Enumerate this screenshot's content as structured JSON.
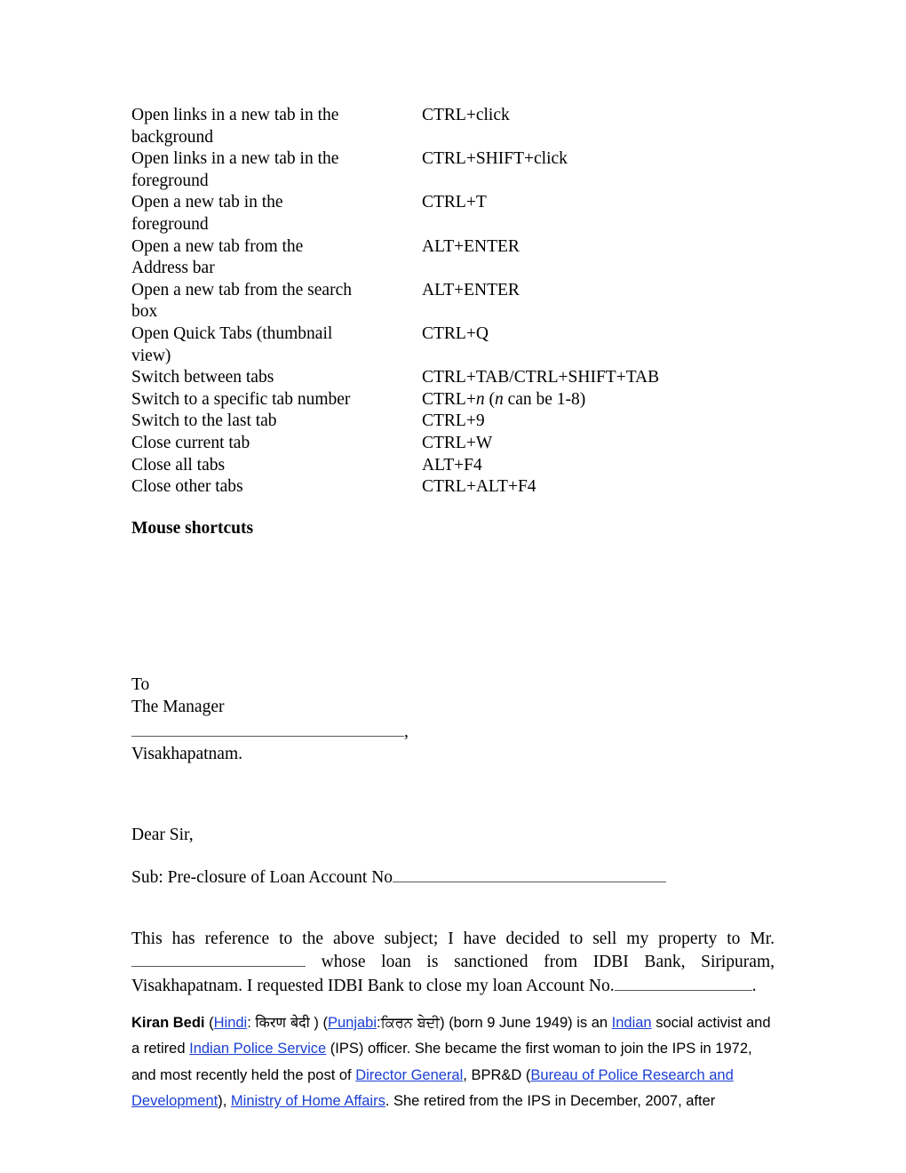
{
  "document": {
    "shortcuts_table": {
      "rows": [
        {
          "description": "Open links in a new tab in the background",
          "keys": "CTRL+click"
        },
        {
          "description": "Open links in a new tab in the foreground",
          "keys": "CTRL+SHIFT+click"
        },
        {
          "description": "Open a new tab in the foreground",
          "keys": "CTRL+T"
        },
        {
          "description": "Open a new tab from the Address bar",
          "keys": "ALT+ENTER"
        },
        {
          "description": "Open a new tab from the search box",
          "keys": "ALT+ENTER"
        },
        {
          "description": "Open Quick Tabs (thumbnail view)",
          "keys": "CTRL+Q"
        },
        {
          "description": "Switch between tabs",
          "keys": "CTRL+TAB/CTRL+SHIFT+TAB"
        },
        {
          "description": "Switch to a specific tab number",
          "keys_prefix": "CTRL+",
          "keys_italic": "n",
          "keys_suffix_open": " (",
          "keys_italic2": "n",
          "keys_suffix": " can be 1-8)"
        },
        {
          "description": "Switch to the last tab",
          "keys": "CTRL+9"
        },
        {
          "description": "Close current tab",
          "keys": "CTRL+W"
        },
        {
          "description": "Close all tabs",
          "keys": "ALT+F4"
        },
        {
          "description": "Close other tabs",
          "keys": "CTRL+ALT+F4"
        }
      ]
    },
    "mouse_shortcuts_heading": "Mouse shortcuts",
    "letter": {
      "to": "To",
      "recipient": "The Manager",
      "address_blank_suffix": ",",
      "city": "Visakhapatnam.",
      "salutation": "Dear Sir,",
      "subject_prefix": "Sub: Pre-closure of Loan Account No",
      "body_part1": "This has reference to the above subject; I have decided to sell my property to Mr.",
      "body_part2": "whose loan is sanctioned from IDBI Bank, Siripuram, Visakhapatnam. I requested IDBI Bank to close my loan Account No.",
      "body_part3": "."
    },
    "wiki_paragraph": {
      "name_bold": "Kiran Bedi",
      "open_paren": " (",
      "link_hindi": "Hindi",
      "hindi_colon": ": ",
      "hindi_script": "किरण बेदी",
      "hindi_close": " ) (",
      "link_punjabi": "Punjabi",
      "punjabi_colon": ":",
      "punjabi_script": "ਕਿਰਨ ਬੇਦੀ",
      "punjabi_close": ") ",
      "born_text": "(born 9 June 1949) is an ",
      "link_indian": "Indian",
      "text_after_indian": " social activist and a retired ",
      "link_ips": "Indian Police Service",
      "text_after_ips": " (IPS) officer. She became the first woman to join the IPS in 1972, and most recently held the post of ",
      "link_director_general": "Director General",
      "text_bprd": ", BPR&D (",
      "link_bprd_full": "Bureau of Police Research and Development",
      "text_close_paren": "), ",
      "link_mha": "Ministry of Home Affairs",
      "text_tail": ". She retired from the IPS in December, 2007, after"
    },
    "colors": {
      "link": "#1a3fd4",
      "text": "#000000",
      "underline_rule": "#595959",
      "page_background": "#ffffff"
    }
  }
}
